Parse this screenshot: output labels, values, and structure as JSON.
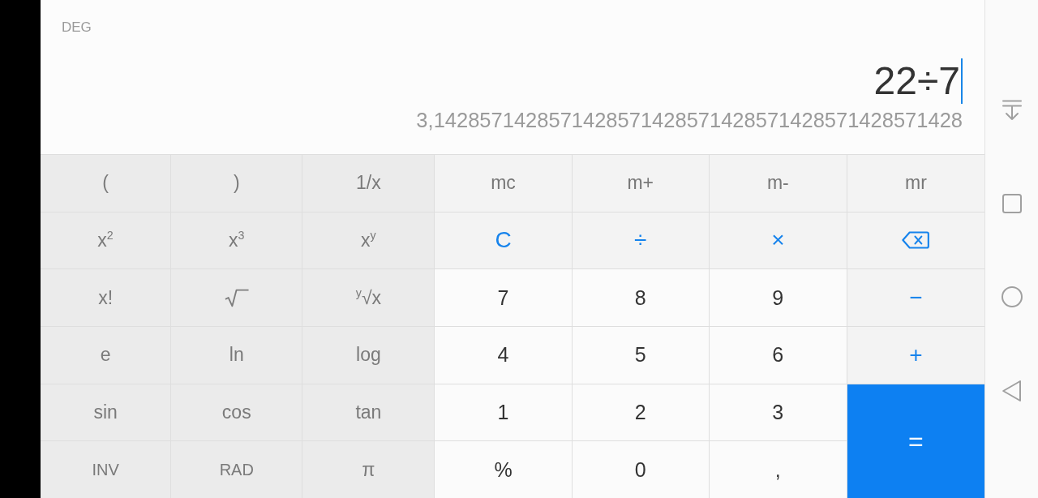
{
  "display": {
    "angle_unit": "DEG",
    "expression": {
      "value": "22÷7",
      "focused": true
    },
    "result": "3,1428571428571428571428571428571428571428571428"
  },
  "keypad": {
    "keys": [
      {
        "label": "(",
        "kind": "function"
      },
      {
        "label": ")",
        "kind": "function"
      },
      {
        "label": "1/x",
        "kind": "function"
      },
      {
        "label": "mc",
        "kind": "memory"
      },
      {
        "label": "m+",
        "kind": "memory"
      },
      {
        "label": "m-",
        "kind": "memory"
      },
      {
        "label": "mr",
        "kind": "memory"
      },
      {
        "label": "x$^{2}$",
        "kind": "function"
      },
      {
        "label": "x$^{3}$",
        "kind": "function"
      },
      {
        "label": "x$^{y}$",
        "kind": "function"
      },
      {
        "label": "C",
        "kind": "operator"
      },
      {
        "label": "÷",
        "kind": "operator"
      },
      {
        "label": "×",
        "kind": "operator"
      },
      {
        "kind": "delete"
      },
      {
        "label": "x!",
        "kind": "function"
      },
      {
        "kind": "root"
      },
      {
        "label": "$^{y}$√x",
        "kind": "function"
      },
      {
        "label": "7",
        "kind": "digit"
      },
      {
        "label": "8",
        "kind": "digit"
      },
      {
        "label": "9",
        "kind": "digit"
      },
      {
        "label": "−",
        "kind": "operator"
      },
      {
        "label": "e",
        "kind": "function"
      },
      {
        "label": "ln",
        "kind": "function"
      },
      {
        "label": "log",
        "kind": "function"
      },
      {
        "label": "4",
        "kind": "digit"
      },
      {
        "label": "5",
        "kind": "digit"
      },
      {
        "label": "6",
        "kind": "digit"
      },
      {
        "label": "+",
        "kind": "operator"
      },
      {
        "label": "sin",
        "kind": "function"
      },
      {
        "label": "cos",
        "kind": "function"
      },
      {
        "label": "tan",
        "kind": "function"
      },
      {
        "label": "1",
        "kind": "digit"
      },
      {
        "label": "2",
        "kind": "digit"
      },
      {
        "label": "3",
        "kind": "digit"
      },
      {
        "label": "=",
        "kind": "equals"
      },
      {
        "label": "INV",
        "kind": "toggle"
      },
      {
        "label": "RAD",
        "kind": "toggle"
      },
      {
        "label": "π",
        "kind": "function"
      },
      {
        "label": "%",
        "kind": "digit"
      },
      {
        "label": "0",
        "kind": "digit"
      },
      {
        "label": ",",
        "kind": "digit"
      }
    ]
  }
}
